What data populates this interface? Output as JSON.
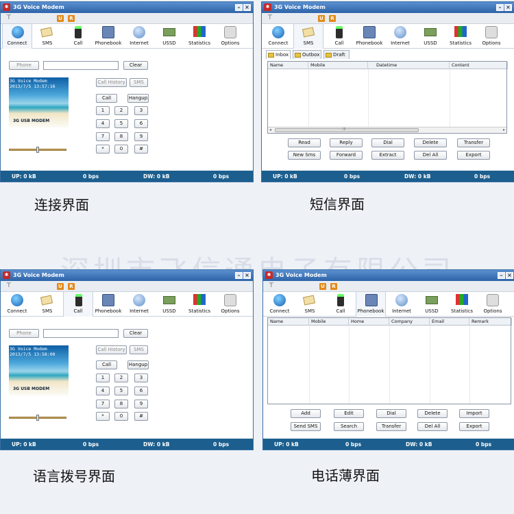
{
  "app": {
    "title": "3G Voice Modem",
    "menu_u": "U",
    "menu_r": "R",
    "filter_icon": "filter-icon"
  },
  "toolbar": [
    "Connect",
    "SMS",
    "Call",
    "Phonebook",
    "Internet",
    "USSD",
    "Statistics",
    "Options"
  ],
  "status": {
    "up": "UP: 0 kB",
    "up_bps": "0 bps",
    "dw": "DW: 0 kB",
    "dw_bps": "0 bps"
  },
  "dial": {
    "phone_label": "Phone",
    "clear": "Clear",
    "call_history": "Call History",
    "sms": "SMS",
    "call": "Call",
    "hangup": "Hangup",
    "keys": [
      "1",
      "2",
      "3",
      "4",
      "5",
      "6",
      "7",
      "8",
      "9",
      "*",
      "0",
      "#"
    ],
    "banner_title": "3G Voice Modem",
    "banner_time_connect": "2013/7/5 13:57:16",
    "banner_time_dial": "2013/7/5 13:58:00",
    "banner_logo": "3G USB MODEM"
  },
  "sms": {
    "tabs": [
      "Inbox",
      "Outbox",
      "Draft"
    ],
    "columns": [
      "Name",
      "Mobile",
      "Datetime",
      "Content"
    ],
    "buttons_row1": [
      "Read",
      "Reply",
      "Dial",
      "Delete",
      "Transfer"
    ],
    "buttons_row2": [
      "New Sms",
      "Forward",
      "Extract",
      "Del All",
      "Export"
    ],
    "scroll_grip": "III"
  },
  "phonebook": {
    "columns": [
      "Name",
      "Mobile",
      "Home",
      "Company",
      "Email",
      "Remark"
    ],
    "buttons_row1": [
      "Add",
      "Edit",
      "Dial",
      "Delete",
      "Import"
    ],
    "buttons_row2": [
      "Send SMS",
      "Search",
      "Transfer",
      "Del All",
      "Export"
    ]
  },
  "captions": {
    "connect": "连接界面",
    "sms": "短信界面",
    "dial": "语言拨号界面",
    "phonebook": "电话薄界面",
    "watermark": "深圳市飞信通电子有限公司"
  },
  "colors": {
    "title": "#2e64a8",
    "status": "#1c5f8e",
    "accent_menu": "#e28a1a"
  }
}
